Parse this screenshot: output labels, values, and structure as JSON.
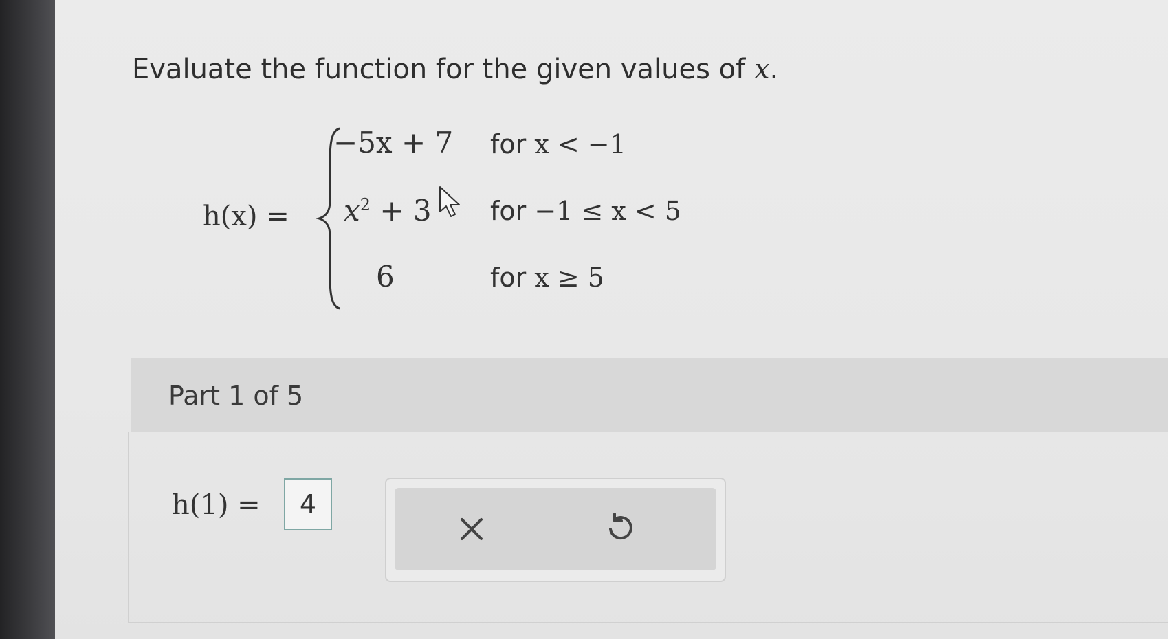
{
  "question": {
    "instruction": "Evaluate the function for the given values of",
    "variable": "x",
    "period": "."
  },
  "function": {
    "lhs": "h(x) =",
    "cases": [
      {
        "expr": "−5x + 7",
        "cond_word": "for",
        "cond_math": "x < −1"
      },
      {
        "expr_base": "x",
        "expr_exp": "2",
        "expr_tail": " + 3",
        "cond_word": "for",
        "cond_math": "−1 ≤ x < 5"
      },
      {
        "expr": "6",
        "cond_word": "for",
        "cond_math": "x ≥ 5"
      }
    ]
  },
  "part": {
    "title": "Part 1 of 5",
    "answer_label": "h(1) =",
    "answer_value": "4"
  },
  "icons": {
    "clear": "close-icon",
    "undo": "undo-icon",
    "cursor": "mouse-pointer-icon"
  },
  "colors": {
    "answer_border": "#7fa7a4",
    "header_bg": "#d8d8d8"
  }
}
